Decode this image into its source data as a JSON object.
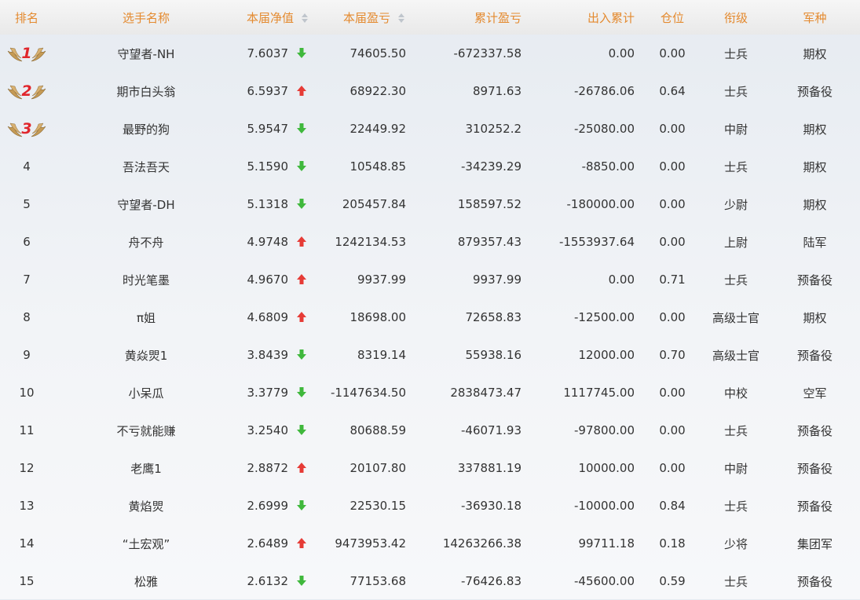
{
  "headers": {
    "rank": "排名",
    "name": "选手名称",
    "nav": "本届净值",
    "pnl": "本届盈亏",
    "cum": "累计盈亏",
    "flow": "出入累计",
    "pos": "仓位",
    "title": "衔级",
    "branch": "军种"
  },
  "colors": {
    "header_text": "#e48a2f",
    "up_arrow": "#e63b36",
    "down_arrow": "#3fb83c",
    "medal_number": "#e0262c",
    "wing": "#c59a54"
  },
  "rows": [
    {
      "rank": "1",
      "medal": true,
      "name": "守望者-NH",
      "nav": "7.6037",
      "trend": "down",
      "pnl": "74605.50",
      "cum": "-672337.58",
      "flow": "0.00",
      "pos": "0.00",
      "title": "士兵",
      "branch": "期权"
    },
    {
      "rank": "2",
      "medal": true,
      "name": "期市白头翁",
      "nav": "6.5937",
      "trend": "up",
      "pnl": "68922.30",
      "cum": "8971.63",
      "flow": "-26786.06",
      "pos": "0.64",
      "title": "士兵",
      "branch": "预备役"
    },
    {
      "rank": "3",
      "medal": true,
      "name": "最野的狗",
      "nav": "5.9547",
      "trend": "down",
      "pnl": "22449.92",
      "cum": "310252.2",
      "flow": "-25080.00",
      "pos": "0.00",
      "title": "中尉",
      "branch": "期权"
    },
    {
      "rank": "4",
      "medal": false,
      "name": "吾法吾天",
      "nav": "5.1590",
      "trend": "down",
      "pnl": "10548.85",
      "cum": "-34239.29",
      "flow": "-8850.00",
      "pos": "0.00",
      "title": "士兵",
      "branch": "期权"
    },
    {
      "rank": "5",
      "medal": false,
      "name": "守望者-DH",
      "nav": "5.1318",
      "trend": "down",
      "pnl": "205457.84",
      "cum": "158597.52",
      "flow": "-180000.00",
      "pos": "0.00",
      "title": "少尉",
      "branch": "期权"
    },
    {
      "rank": "6",
      "medal": false,
      "name": "舟不舟",
      "nav": "4.9748",
      "trend": "up",
      "pnl": "1242134.53",
      "cum": "879357.43",
      "flow": "-1553937.64",
      "pos": "0.00",
      "title": "上尉",
      "branch": "陆军"
    },
    {
      "rank": "7",
      "medal": false,
      "name": "时光笔墨",
      "nav": "4.9670",
      "trend": "up",
      "pnl": "9937.99",
      "cum": "9937.99",
      "flow": "0.00",
      "pos": "0.71",
      "title": "士兵",
      "branch": "预备役"
    },
    {
      "rank": "8",
      "medal": false,
      "name": "π姐",
      "nav": "4.6809",
      "trend": "up",
      "pnl": "18698.00",
      "cum": "72658.83",
      "flow": "-12500.00",
      "pos": "0.00",
      "title": "高级士官",
      "branch": "期权"
    },
    {
      "rank": "9",
      "medal": false,
      "name": "黄焱焸1",
      "nav": "3.8439",
      "trend": "down",
      "pnl": "8319.14",
      "cum": "55938.16",
      "flow": "12000.00",
      "pos": "0.70",
      "title": "高级士官",
      "branch": "预备役"
    },
    {
      "rank": "10",
      "medal": false,
      "name": "小呆瓜",
      "nav": "3.3779",
      "trend": "down",
      "pnl": "-1147634.50",
      "cum": "2838473.47",
      "flow": "1117745.00",
      "pos": "0.00",
      "title": "中校",
      "branch": "空军"
    },
    {
      "rank": "11",
      "medal": false,
      "name": "不亏就能赚",
      "nav": "3.2540",
      "trend": "down",
      "pnl": "80688.59",
      "cum": "-46071.93",
      "flow": "-97800.00",
      "pos": "0.00",
      "title": "士兵",
      "branch": "预备役"
    },
    {
      "rank": "12",
      "medal": false,
      "name": "老鹰1",
      "nav": "2.8872",
      "trend": "up",
      "pnl": "20107.80",
      "cum": "337881.19",
      "flow": "10000.00",
      "pos": "0.00",
      "title": "中尉",
      "branch": "预备役"
    },
    {
      "rank": "13",
      "medal": false,
      "name": "黄焰焸",
      "nav": "2.6999",
      "trend": "down",
      "pnl": "22530.15",
      "cum": "-36930.18",
      "flow": "-10000.00",
      "pos": "0.84",
      "title": "士兵",
      "branch": "预备役"
    },
    {
      "rank": "14",
      "medal": false,
      "name": "“土宏观”",
      "nav": "2.6489",
      "trend": "up",
      "pnl": "9473953.42",
      "cum": "14263266.38",
      "flow": "99711.18",
      "pos": "0.18",
      "title": "少将",
      "branch": "集团军"
    },
    {
      "rank": "15",
      "medal": false,
      "name": "松雅",
      "nav": "2.6132",
      "trend": "down",
      "pnl": "77153.68",
      "cum": "-76426.83",
      "flow": "-45600.00",
      "pos": "0.59",
      "title": "士兵",
      "branch": "预备役"
    }
  ]
}
